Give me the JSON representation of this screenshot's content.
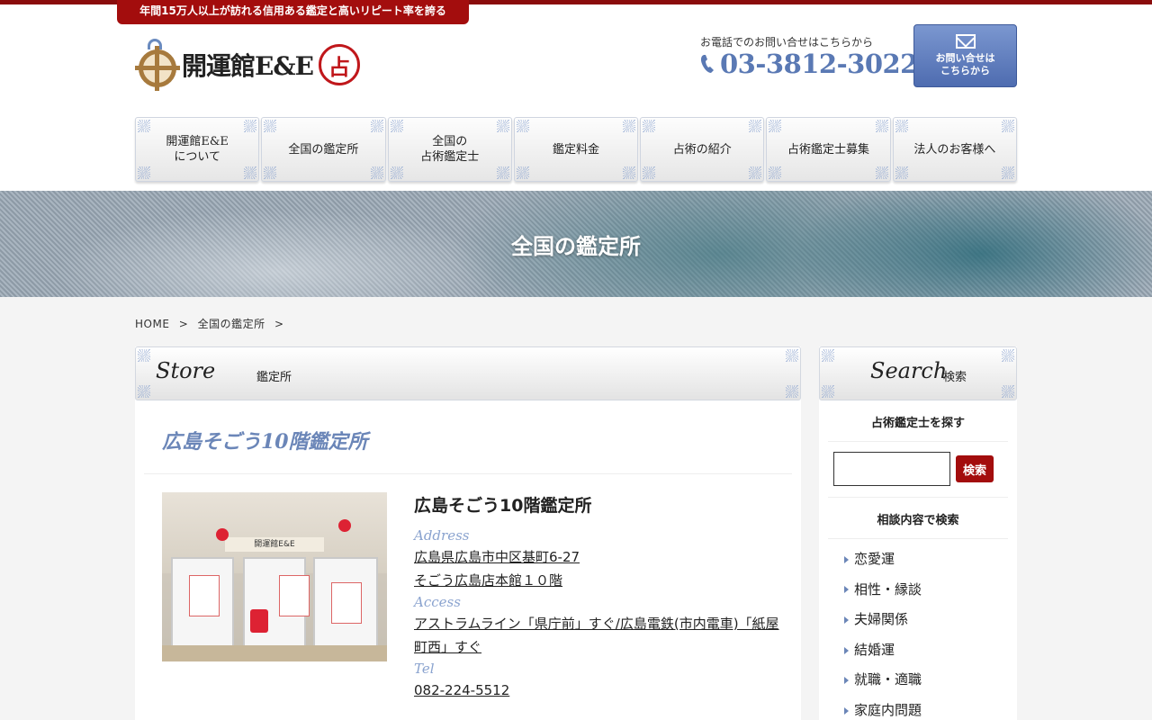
{
  "header": {
    "tagline": "年間15万人以上が訪れる信用ある鑑定と高いリピート率を誇る",
    "logo_text": "開運館E&E",
    "logo_seal": "占",
    "tel_label": "お電話でのお問い合せはこちらから",
    "tel_number": "03-3812-3022",
    "contact_line1": "お問い合せは",
    "contact_line2": "こちらから"
  },
  "nav": {
    "items": [
      {
        "label": "開運館E&E\nについて"
      },
      {
        "label": "全国の鑑定所"
      },
      {
        "label": "全国の\n占術鑑定士"
      },
      {
        "label": "鑑定料金"
      },
      {
        "label": "占術の紹介"
      },
      {
        "label": "占術鑑定士募集"
      },
      {
        "label": "法人のお客様へ"
      }
    ]
  },
  "hero": {
    "title": "全国の鑑定所"
  },
  "breadcrumb": {
    "home": "HOME",
    "sep": ">",
    "current": "全国の鑑定所"
  },
  "main": {
    "section_en": "Store",
    "section_ja": "鑑定所",
    "store_title": "広島そごう10階鑑定所",
    "photo_sign": "開運館E&E",
    "info": {
      "name": "広島そごう10階鑑定所",
      "address_label": "Address",
      "address_line1": "広島県広島市中区基町6-27",
      "address_line2": "そごう広島店本館１０階",
      "access_label": "Access",
      "access_value": "アストラムライン「県庁前」すぐ/広島電鉄(市内電車)「紙屋町西」すぐ",
      "tel_label": "Tel",
      "tel_value": "082-224-5512"
    }
  },
  "sidebar": {
    "section_en": "Search",
    "section_ja": "検索",
    "find_label": "占術鑑定士を探す",
    "search_button": "検索",
    "search_value": "",
    "topic_label": "相談内容で検索",
    "topics": [
      "恋愛運",
      "相性・縁談",
      "夫婦関係",
      "結婚運",
      "就職・適職",
      "家庭内問題"
    ]
  },
  "colors": {
    "brand_red": "#a30d0d",
    "accent_blue": "#6b86b8"
  }
}
